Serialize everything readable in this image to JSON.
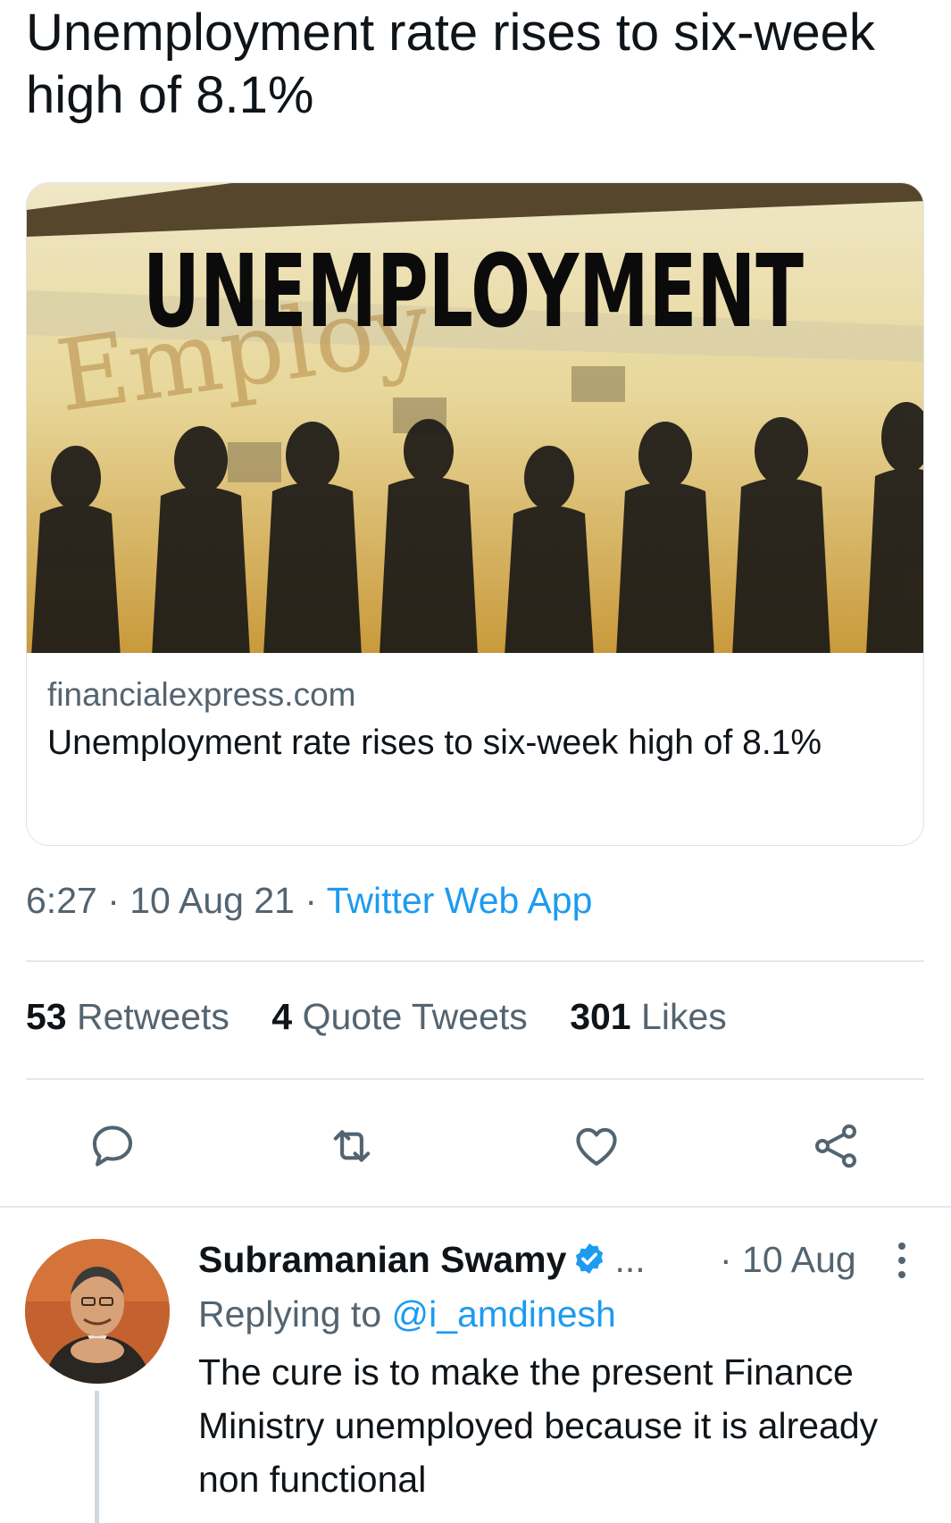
{
  "tweet": {
    "text": "Unemployment rate rises to six-week high of 8.1%"
  },
  "card": {
    "image_headline": "UNEMPLOYMENT",
    "domain": "financialexpress.com",
    "title": "Unemployment rate rises to six-week high of 8.1%"
  },
  "meta": {
    "time": "6:27",
    "date": "10 Aug 21",
    "separator": " · ",
    "source": "Twitter Web App"
  },
  "stats": [
    {
      "count": "53",
      "label": "Retweets"
    },
    {
      "count": "4",
      "label": "Quote Tweets"
    },
    {
      "count": "301",
      "label": "Likes"
    }
  ],
  "actions": {
    "reply_icon": "reply-icon",
    "retweet_icon": "retweet-icon",
    "like_icon": "heart-icon",
    "share_icon": "share-icon"
  },
  "reply": {
    "author": "Subramanian Swamy",
    "ellipsis": "...",
    "date": "· 10 Aug",
    "replying_prefix": "Replying to ",
    "replying_handle": "@i_amdinesh",
    "text": "The cure is to make the present Finance Ministry unemployed because it is already non functional"
  },
  "colors": {
    "accent": "#1d9bf0",
    "secondary_text": "#536471",
    "primary_text": "#0f1419",
    "divider": "#e4e8eb"
  }
}
